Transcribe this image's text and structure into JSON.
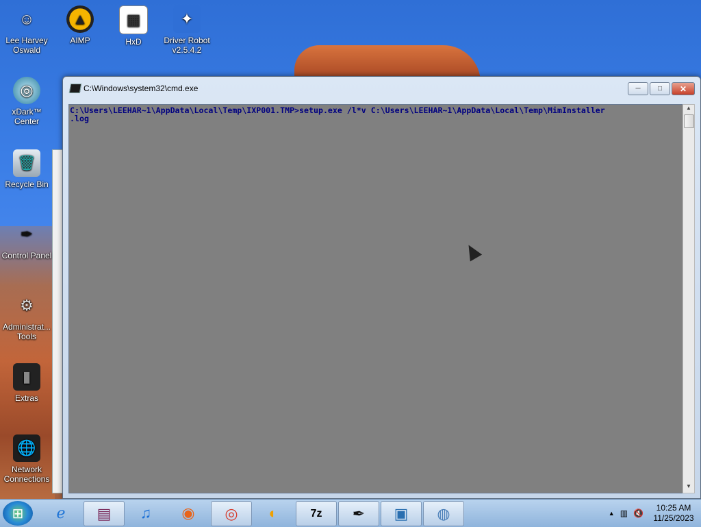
{
  "desktop": {
    "icons": [
      {
        "label": "Lee Harvey\nOswald",
        "glyph": "☺",
        "color": "#eeeeee"
      },
      {
        "label": "AIMP",
        "glyph": "▲",
        "color": "#222222"
      },
      {
        "label": "HxD",
        "glyph": "▦",
        "color": "#ffffff"
      },
      {
        "label": "Driver Robot\nv2.5.4.2",
        "glyph": "✦",
        "color": "#2f6fd6"
      },
      {
        "label": "xDark™\nCenter",
        "glyph": "◎",
        "color": "#4aa3c2"
      },
      {
        "label": "Recycle Bin",
        "glyph": "🗑",
        "color": "#cfd8e0"
      },
      {
        "label": "Control Panel",
        "glyph": "✒",
        "color": "#111111"
      },
      {
        "label": "Administrat...\nTools",
        "glyph": "⚙",
        "color": "#9aa0a6"
      },
      {
        "label": "Extras",
        "glyph": "▮",
        "color": "#222222"
      },
      {
        "label": "Network\nConnections",
        "glyph": "🌐",
        "color": "#1e5aa8"
      }
    ]
  },
  "cmd_window": {
    "title": "C:\\Windows\\system32\\cmd.exe",
    "minimize_label": "─",
    "maximize_label": "□",
    "close_label": "✕",
    "console_text": "C:\\Users\\LEEHAR~1\\AppData\\Local\\Temp\\IXP001.TMP>setup.exe /l*v C:\\Users\\LEEHAR~1\\AppData\\Local\\Temp\\MimInstaller\n.log",
    "scroll_up": "▲",
    "scroll_down": "▼"
  },
  "taskbar": {
    "start_glyph": "⊞",
    "items": [
      {
        "name": "ie",
        "glyph": "ℯ",
        "boxed": false
      },
      {
        "name": "winrar",
        "glyph": "▤",
        "boxed": true
      },
      {
        "name": "itunes",
        "glyph": "♫",
        "boxed": false
      },
      {
        "name": "firefox",
        "glyph": "◉",
        "boxed": false
      },
      {
        "name": "chrome",
        "glyph": "◎",
        "boxed": true
      },
      {
        "name": "aimp",
        "glyph": "◐",
        "boxed": false
      },
      {
        "name": "7zip",
        "glyph": "7z",
        "boxed": true
      },
      {
        "name": "control-panel",
        "glyph": "✒",
        "boxed": true
      },
      {
        "name": "monitor",
        "glyph": "▣",
        "boxed": true
      },
      {
        "name": "installer",
        "glyph": "◍",
        "boxed": true
      }
    ],
    "tray": {
      "expand": "▲",
      "network": "▥",
      "volume": "🔇",
      "time": "10:25 AM",
      "date": "11/25/2023"
    }
  }
}
